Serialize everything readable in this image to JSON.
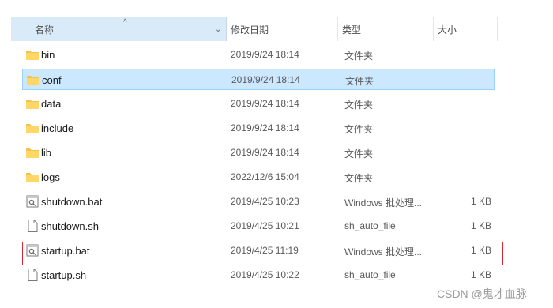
{
  "top_strip": {
    "crumb": ""
  },
  "header": {
    "name": "名称",
    "date": "修改日期",
    "type": "类型",
    "size": "大小"
  },
  "files": [
    {
      "name": "bin",
      "date": "2019/9/24 18:14",
      "type": "文件夹",
      "size": "",
      "icon": "folder-icon",
      "selected": false
    },
    {
      "name": "conf",
      "date": "2019/9/24 18:14",
      "type": "文件夹",
      "size": "",
      "icon": "folder-icon",
      "selected": true
    },
    {
      "name": "data",
      "date": "2019/9/24 18:14",
      "type": "文件夹",
      "size": "",
      "icon": "folder-icon",
      "selected": false
    },
    {
      "name": "include",
      "date": "2019/9/24 18:14",
      "type": "文件夹",
      "size": "",
      "icon": "folder-icon",
      "selected": false
    },
    {
      "name": "lib",
      "date": "2019/9/24 18:14",
      "type": "文件夹",
      "size": "",
      "icon": "folder-icon",
      "selected": false
    },
    {
      "name": "logs",
      "date": "2022/12/6 15:04",
      "type": "文件夹",
      "size": "",
      "icon": "folder-icon",
      "selected": false
    },
    {
      "name": "shutdown.bat",
      "date": "2019/4/25 10:23",
      "type": "Windows 批处理...",
      "size": "1 KB",
      "icon": "batch-file-icon",
      "selected": false
    },
    {
      "name": "shutdown.sh",
      "date": "2019/4/25 10:21",
      "type": "sh_auto_file",
      "size": "1 KB",
      "icon": "file-icon",
      "selected": false
    },
    {
      "name": "startup.bat",
      "date": "2019/4/25 11:19",
      "type": "Windows 批处理...",
      "size": "1 KB",
      "icon": "batch-file-icon",
      "selected": false
    },
    {
      "name": "startup.sh",
      "date": "2019/4/25 10:22",
      "type": "sh_auto_file",
      "size": "1 KB",
      "icon": "file-icon",
      "selected": false
    }
  ],
  "colors": {
    "selection": "#cce8ff",
    "selection_border": "#99d1ff",
    "header_active": "#d9ebf9",
    "highlight_box": "#d7262f",
    "folder": "#f5c24c"
  },
  "watermark": "CSDN @鬼才血脉"
}
